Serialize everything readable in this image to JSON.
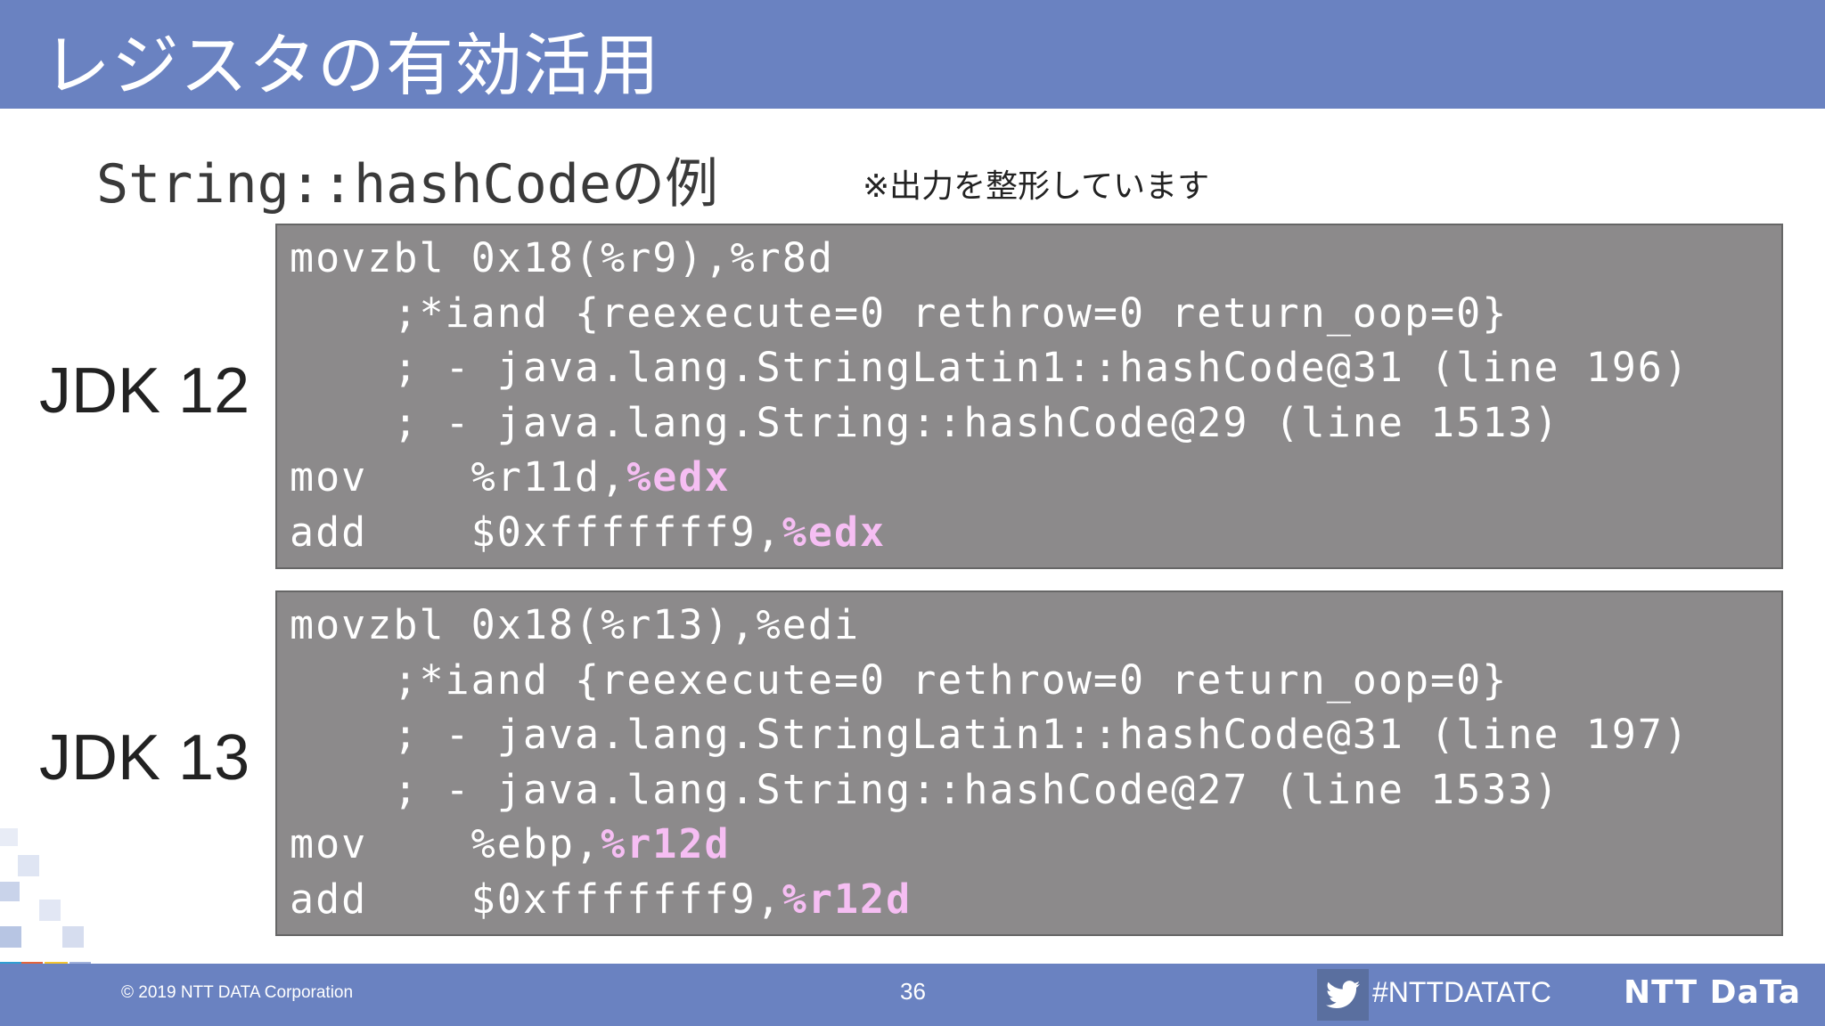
{
  "slide": {
    "title": "レジスタの有効活用",
    "subtitle": "String::hashCodeの例",
    "note": "※出力を整形しています"
  },
  "blocks": [
    {
      "label": "JDK 12",
      "lines": [
        {
          "text": "movzbl 0x18(%r9),%r8d",
          "hl": ""
        },
        {
          "text": "    ;*iand {reexecute=0 rethrow=0 return_oop=0}",
          "hl": ""
        },
        {
          "text": "    ; - java.lang.StringLatin1::hashCode@31 (line 196)",
          "hl": ""
        },
        {
          "text": "    ; - java.lang.String::hashCode@29 (line 1513)",
          "hl": ""
        },
        {
          "text": "mov    %r11d,",
          "hl": "%edx"
        },
        {
          "text": "add    $0xfffffff9,",
          "hl": "%edx"
        }
      ]
    },
    {
      "label": "JDK 13",
      "lines": [
        {
          "text": "movzbl 0x18(%r13),%edi",
          "hl": ""
        },
        {
          "text": "    ;*iand {reexecute=0 rethrow=0 return_oop=0}",
          "hl": ""
        },
        {
          "text": "    ; - java.lang.StringLatin1::hashCode@31 (line 197)",
          "hl": ""
        },
        {
          "text": "    ; - java.lang.String::hashCode@27 (line 1533)",
          "hl": ""
        },
        {
          "text": "mov    %ebp,",
          "hl": "%r12d"
        },
        {
          "text": "add    $0xfffffff9,",
          "hl": "%r12d"
        }
      ]
    }
  ],
  "footer": {
    "copyright": "© 2019 NTT DATA Corporation",
    "page": "36",
    "hashtag": "#NTTDATATC",
    "logo": "NTT DaTa"
  },
  "colors": {
    "header": "#6a82c1",
    "code_bg": "#8c8a8b",
    "highlight": "#f6bef3"
  },
  "icons": {
    "twitter": "twitter-bird-icon"
  }
}
